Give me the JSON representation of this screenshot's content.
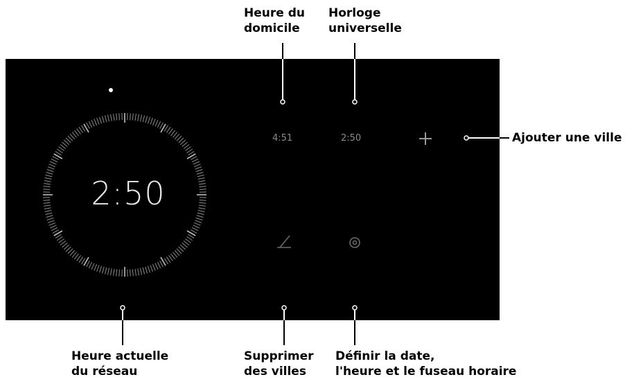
{
  "screen": {
    "background": "#000000",
    "current_time": "2:50",
    "home_time": "4:51",
    "world_time": "2:50"
  },
  "icons": {
    "add": "plus-icon",
    "delete": "trash-icon",
    "settings": "gear-icon",
    "clock_face": "clock-face-ring"
  },
  "callouts": {
    "home_time": [
      "Heure du",
      "domicile"
    ],
    "world_clock": [
      "Horloge",
      "universelle"
    ],
    "add_city": "Ajouter une ville",
    "network_time": [
      "Heure actuelle",
      "du réseau"
    ],
    "delete_cities": [
      "Supprimer",
      "des villes"
    ],
    "set_date": [
      "Définir la date,",
      "l'heure et le fuseau horaire"
    ]
  }
}
